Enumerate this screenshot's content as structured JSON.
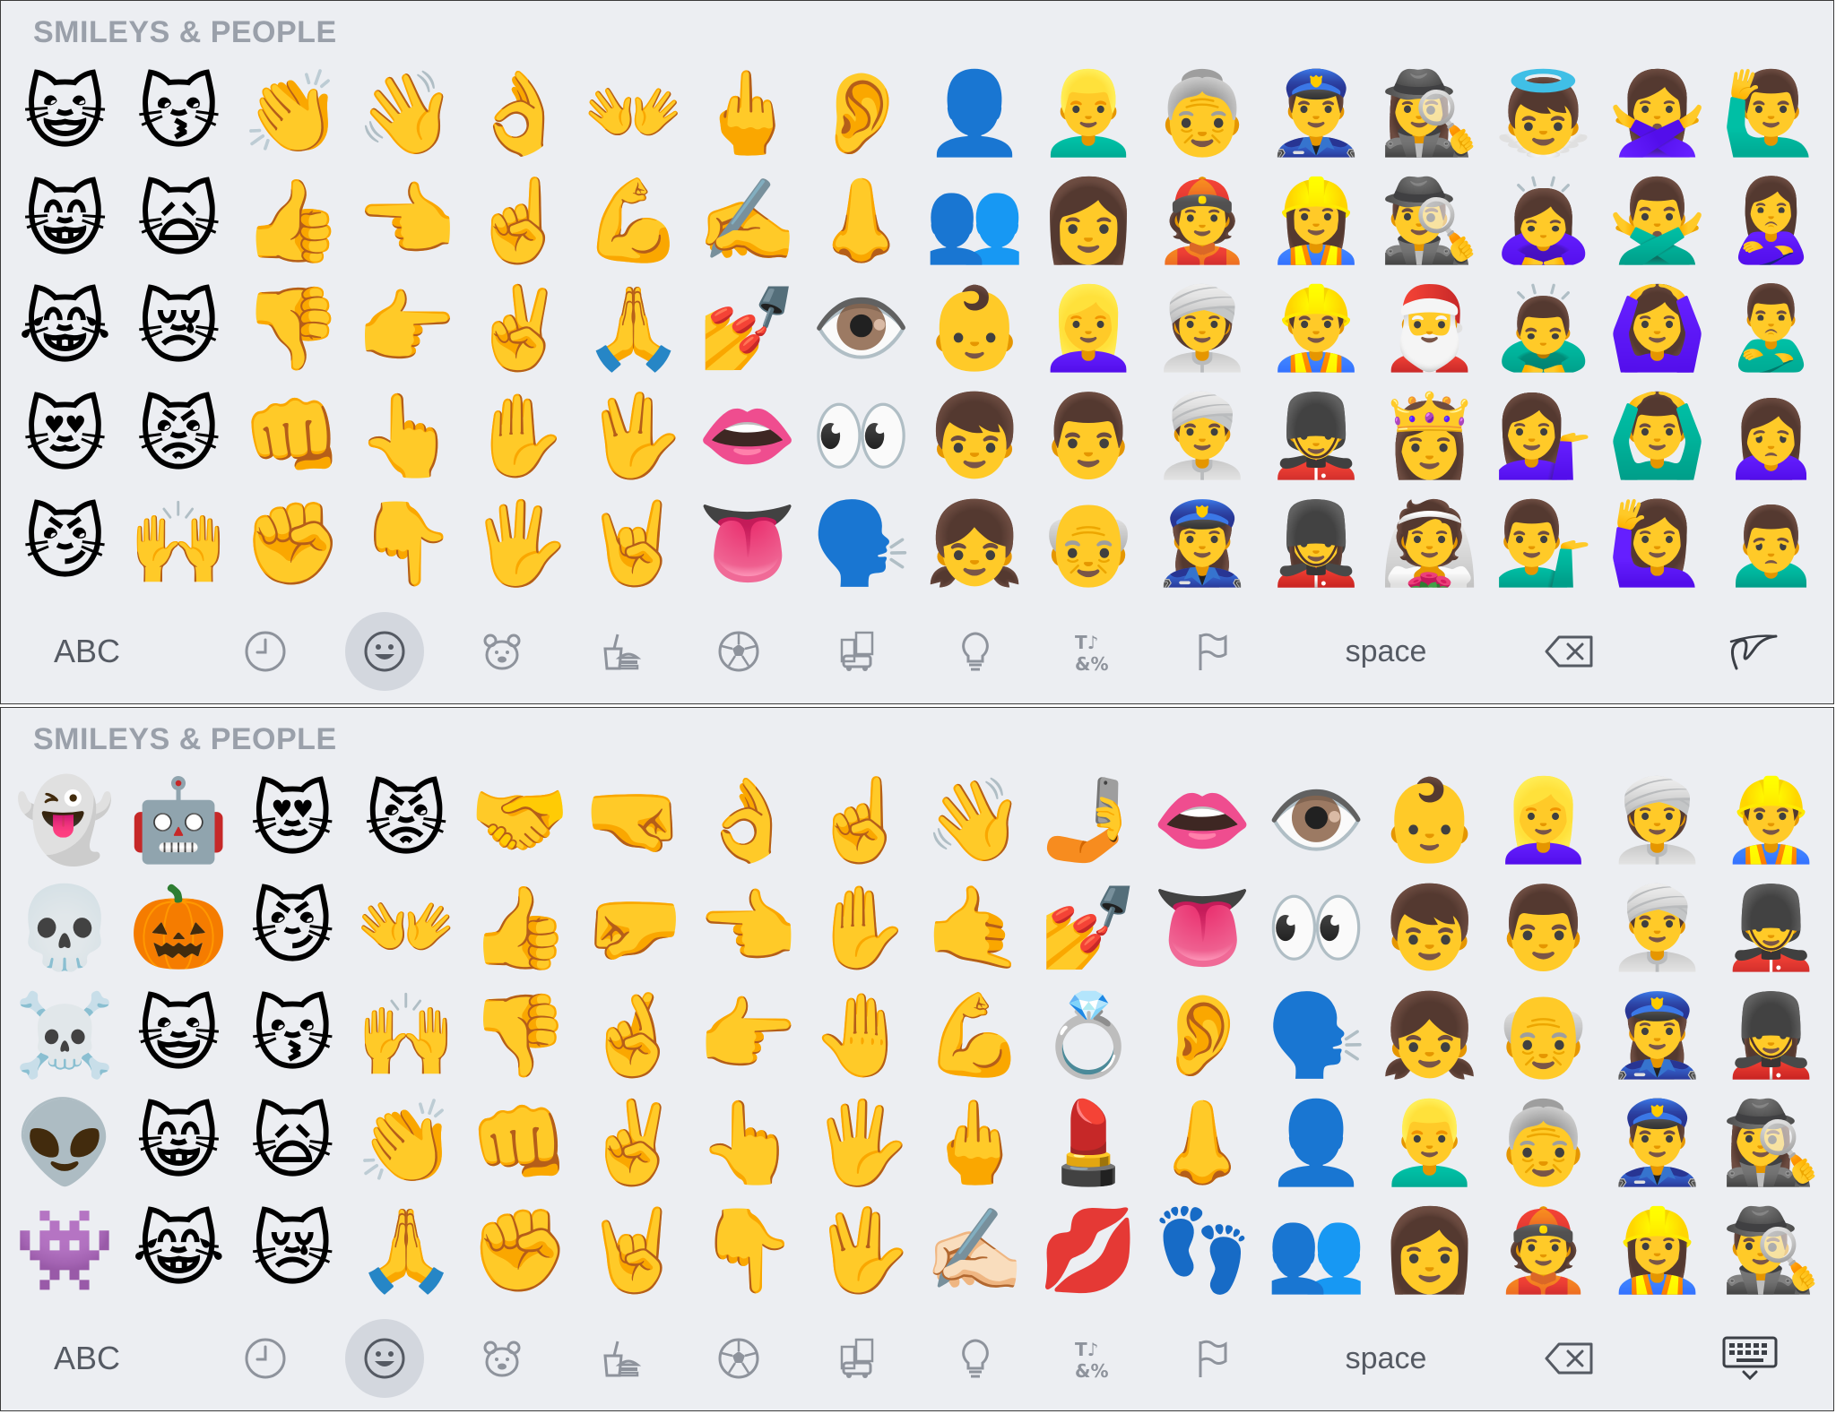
{
  "panels": [
    {
      "section_title": "SMILEYS & PEOPLE",
      "emoji_rows": [
        [
          "😺",
          "😽",
          "👏",
          "👋",
          "👌",
          "👐",
          "🖕",
          "👂",
          "👤",
          "👱‍♂️",
          "👵",
          "👮‍♂️",
          "🕵️‍♀️",
          "👼",
          "🙅‍♀️",
          "🙋‍♂️"
        ],
        [
          "😸",
          "🙀",
          "👍",
          "👈",
          "☝️",
          "💪",
          "✍️",
          "👃",
          "👥",
          "👩",
          "👲",
          "👷‍♀️",
          "🕵️‍♂️",
          "🙇‍♀️",
          "🙅‍♂️",
          "🙎‍♀️"
        ],
        [
          "😹",
          "😿",
          "👎",
          "👉",
          "✌️",
          "🙏",
          "💅",
          "👁️",
          "👶",
          "👱‍♀️",
          "👳‍♀️",
          "👷‍♂️",
          "🎅",
          "🙇‍♂️",
          "🙆‍♀️",
          "🙎‍♂️"
        ],
        [
          "😻",
          "😾",
          "👊",
          "👆",
          "✋",
          "🖖",
          "👄",
          "👀",
          "👦",
          "👨",
          "👳‍♂️",
          "💂‍♂️",
          "👸",
          "💁‍♀️",
          "🙆‍♂️",
          "🙍‍♀️"
        ],
        [
          "😼",
          "🙌",
          "✊",
          "👇",
          "🖐️",
          "🤘",
          "👅",
          "🗣️",
          "👧",
          "👴",
          "👮‍♀️",
          "💂‍♀️",
          "👰",
          "💁‍♂️",
          "🙋‍♀️",
          "🙍‍♂️"
        ]
      ],
      "bar": {
        "abc_label": "ABC",
        "space_label": "space",
        "last_key_icon": "handwriting-icon"
      }
    },
    {
      "section_title": "SMILEYS & PEOPLE",
      "emoji_rows": [
        [
          "👻",
          "🤖",
          "😻",
          "😾",
          "🤝",
          "🤜",
          "👌",
          "☝️",
          "👋",
          "🤳",
          "👄",
          "👁️",
          "👶",
          "👱‍♀️",
          "👳‍♀️",
          "👷‍♂️"
        ],
        [
          "💀",
          "🎃",
          "😼",
          "👐",
          "👍",
          "🤛",
          "👈",
          "✋",
          "🤙",
          "💅",
          "👅",
          "👀",
          "👦",
          "👨",
          "👳‍♂️",
          "💂‍♂️"
        ],
        [
          "☠️",
          "😺",
          "😽",
          "🙌",
          "👎",
          "🤞",
          "👉",
          "🤚",
          "💪",
          "💍",
          "👂",
          "🗣️",
          "👧",
          "👴",
          "👮‍♀️",
          "💂‍♀️"
        ],
        [
          "👽",
          "😸",
          "🙀",
          "👏",
          "👊",
          "✌️",
          "👆",
          "🖐️",
          "🖕",
          "💄",
          "👃",
          "👤",
          "👱‍♂️",
          "👵",
          "👮‍♂️",
          "🕵️‍♀️"
        ],
        [
          "👾",
          "😹",
          "😿",
          "🙏",
          "✊",
          "🤘",
          "👇",
          "🖖",
          "✍🏻",
          "💋",
          "👣",
          "👥",
          "👩",
          "👲",
          "👷‍♀️",
          "🕵️‍♂️"
        ]
      ],
      "bar": {
        "abc_label": "ABC",
        "space_label": "space",
        "last_key_icon": "dismiss-keyboard-icon"
      }
    }
  ],
  "categories": [
    {
      "name": "recent",
      "icon": "clock-icon"
    },
    {
      "name": "smileys-people",
      "icon": "smiley-icon",
      "active": true
    },
    {
      "name": "animals-nature",
      "icon": "bear-icon"
    },
    {
      "name": "food-drink",
      "icon": "burger-drink-icon"
    },
    {
      "name": "activity",
      "icon": "soccer-ball-icon"
    },
    {
      "name": "travel-places",
      "icon": "buildings-car-icon"
    },
    {
      "name": "objects",
      "icon": "lightbulb-icon"
    },
    {
      "name": "symbols",
      "icon": "symbols-icon"
    },
    {
      "name": "flags",
      "icon": "flag-icon"
    }
  ],
  "colors": {
    "keyboard_bg": "#eceef2",
    "title_gray": "#9aa0aa",
    "icon_gray": "#8e939c",
    "active_bg": "#d3d7de"
  }
}
